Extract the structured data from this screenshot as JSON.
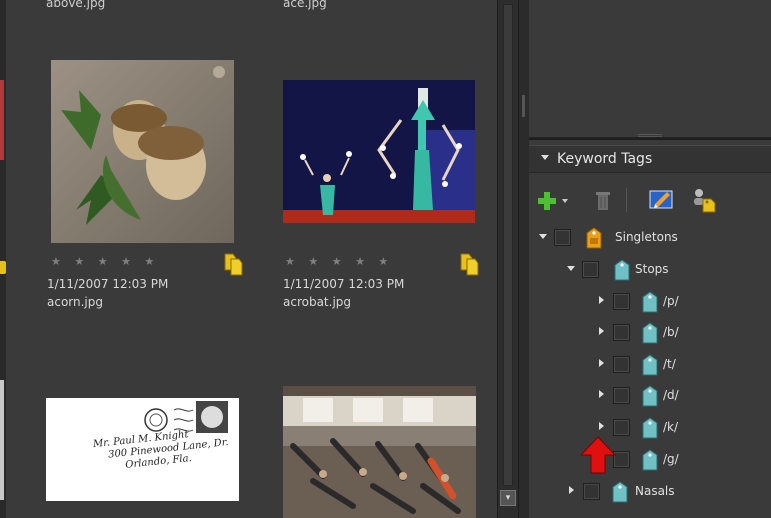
{
  "browser": {
    "top_labels": [
      "above.jpg",
      "ace.jpg"
    ],
    "items": [
      {
        "rating": "★ ★ ★ ★ ★",
        "date": "1/11/2007 12:03 PM",
        "filename": "acorn.jpg"
      },
      {
        "rating": "★ ★ ★ ★ ★",
        "date": "1/11/2007 12:03 PM",
        "filename": "acrobat.jpg"
      }
    ],
    "envelope_text": [
      "Mr. Paul M. Knight",
      "300 Pinewood Lane, Dr.",
      "Orlando, Fla."
    ]
  },
  "keyword_panel": {
    "title": "Keyword Tags",
    "toolbar": {
      "new_icon": "green-plus-icon",
      "delete_icon": "trash-icon",
      "edit_icon": "pencil-edit-icon",
      "tag_icon": "tag-person-icon"
    },
    "tree": [
      {
        "label": "Singletons",
        "expanded": true,
        "icon": "orange-tag-icon"
      },
      {
        "label": "Stops",
        "expanded": true,
        "icon": "teal-tag-icon"
      },
      {
        "label": "/p/",
        "expanded": false,
        "icon": "teal-tag-icon"
      },
      {
        "label": "/b/",
        "expanded": false,
        "icon": "teal-tag-icon"
      },
      {
        "label": "/t/",
        "expanded": false,
        "icon": "teal-tag-icon"
      },
      {
        "label": "/d/",
        "expanded": false,
        "icon": "teal-tag-icon"
      },
      {
        "label": "/k/",
        "expanded": false,
        "icon": "teal-tag-icon"
      },
      {
        "label": "/g/",
        "expanded": false,
        "icon": "teal-tag-icon"
      },
      {
        "label": "Nasals",
        "expanded": false,
        "icon": "teal-tag-icon"
      }
    ]
  },
  "colors": {
    "panel_bg": "#3a3a3a",
    "orange_tag": "#e8a11c",
    "teal_tag": "#6fc1c6",
    "annotation_arrow": "#e01010"
  }
}
